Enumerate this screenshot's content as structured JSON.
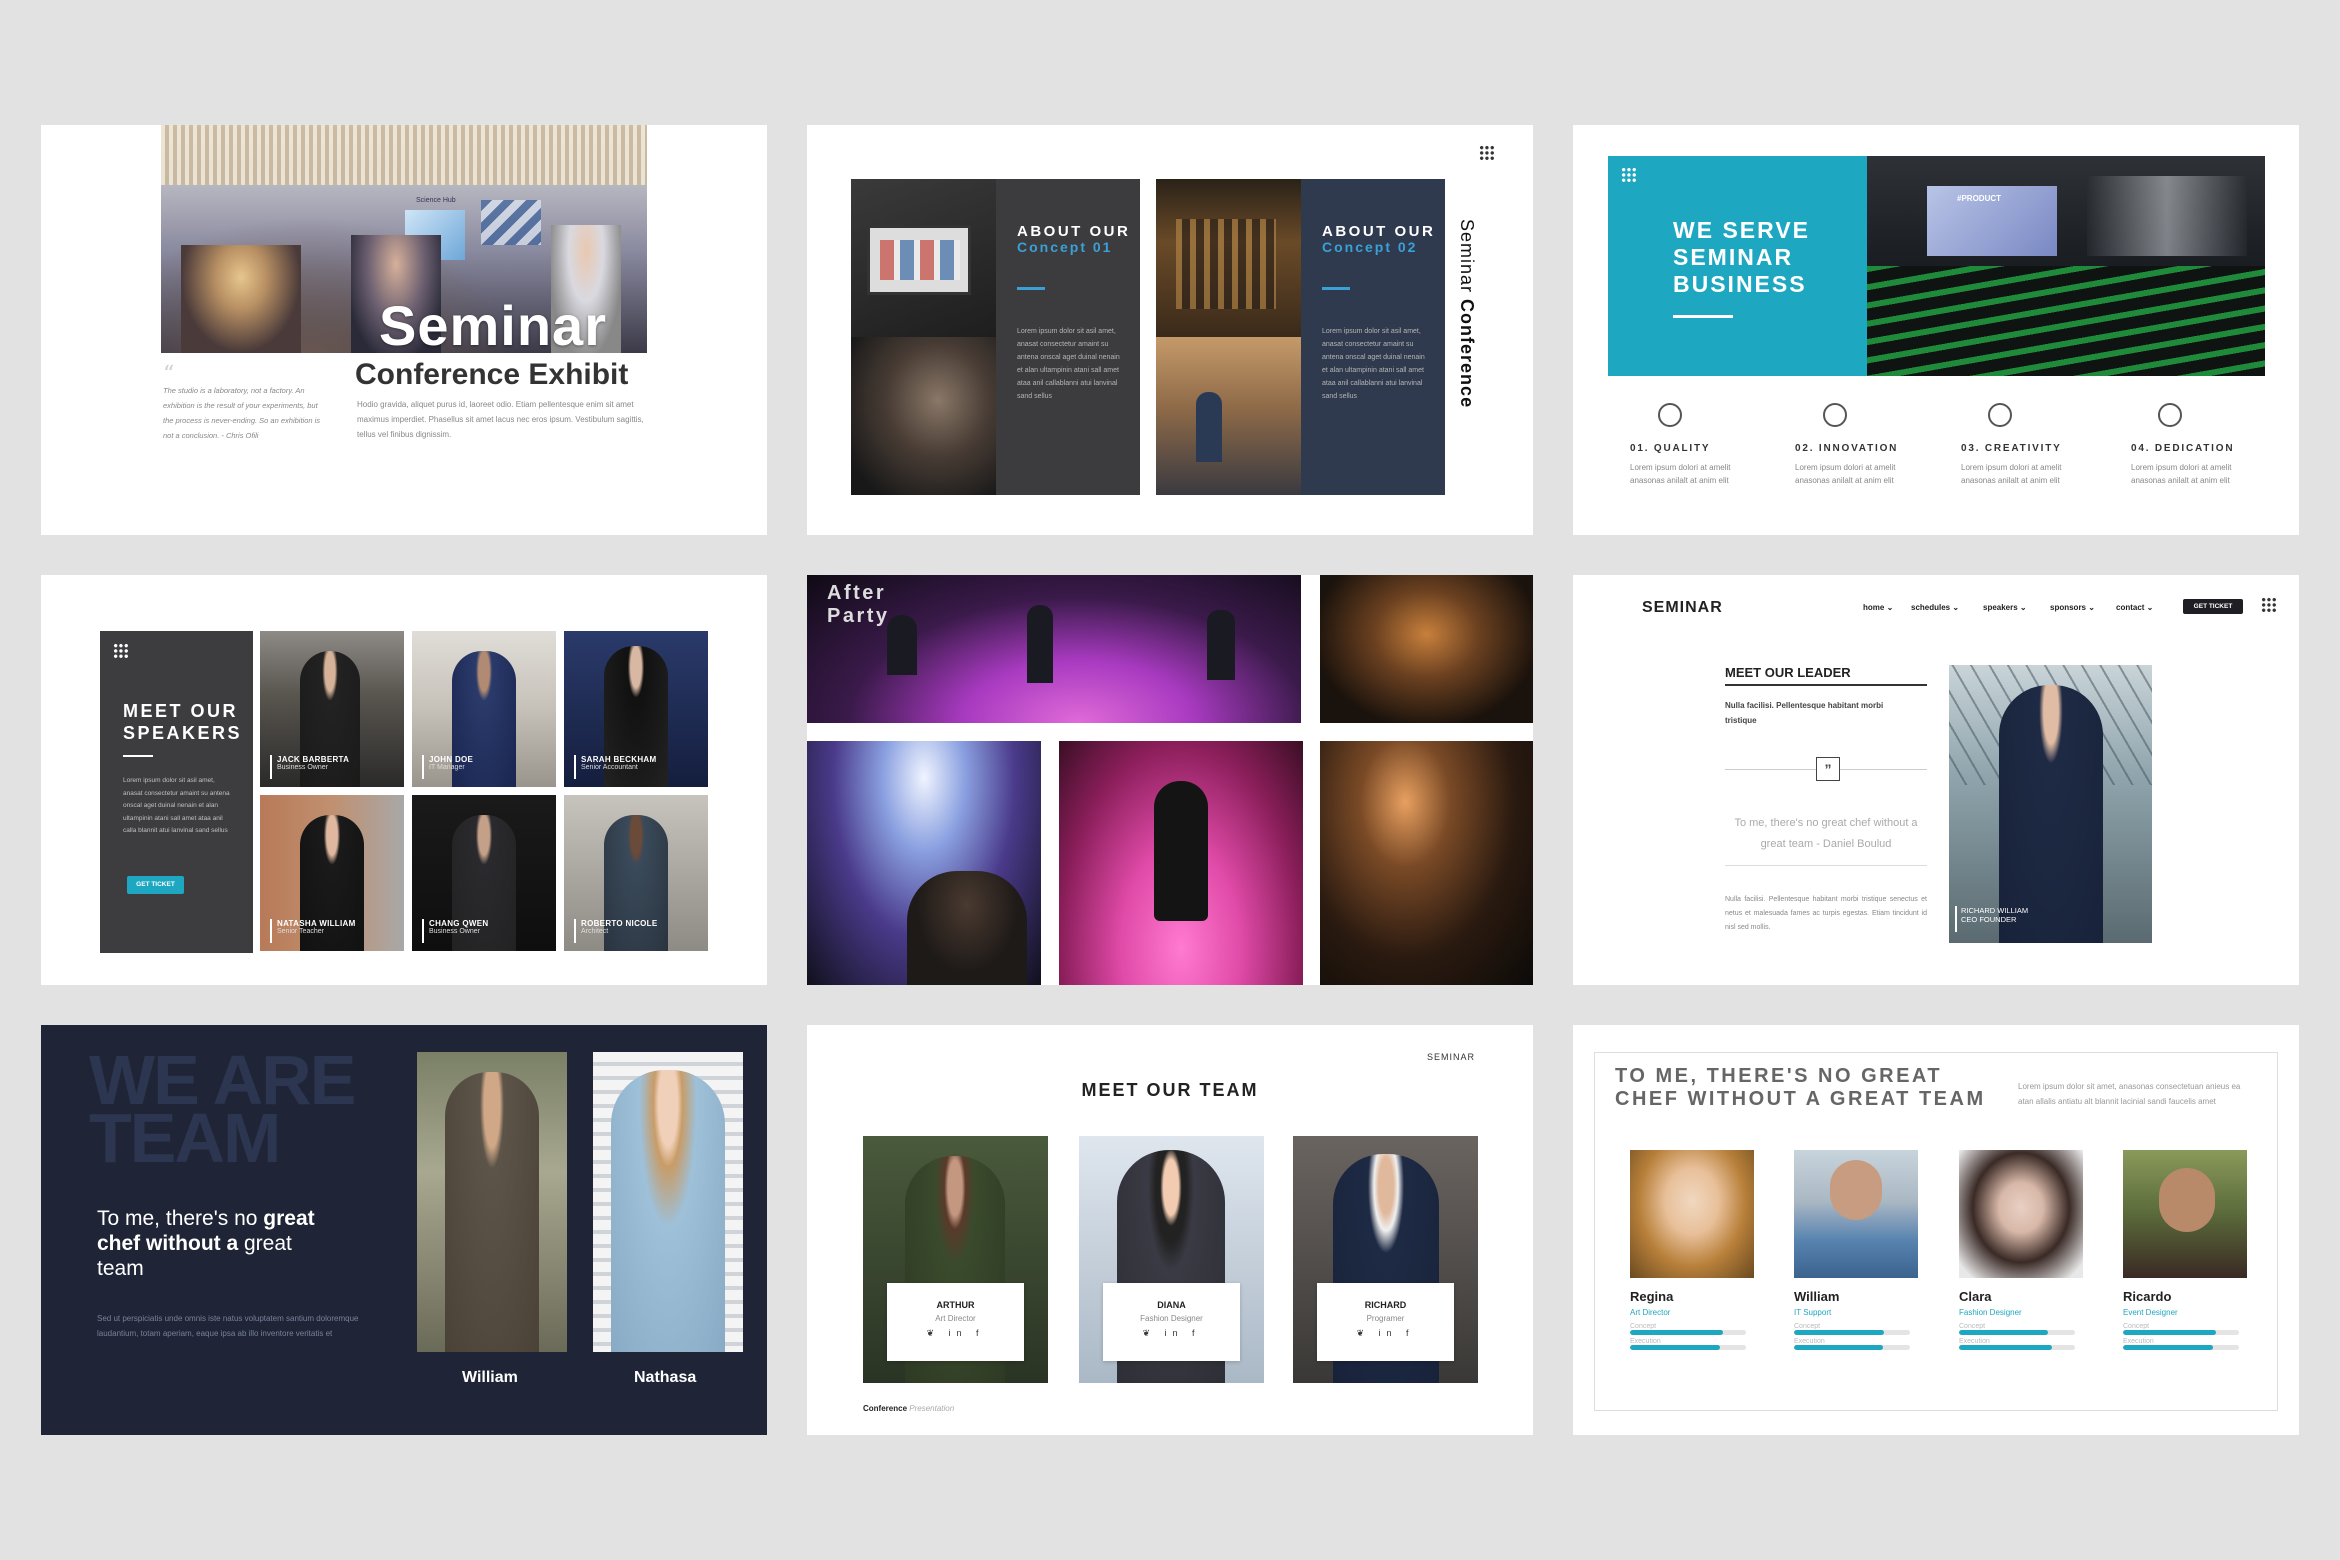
{
  "slide1": {
    "title": "Seminar",
    "subtitle": "Conference Exhibit",
    "photo_sign": "Science Hub",
    "quote": "The studio is a laboratory, not a factory. An exhibition is the result of your experiments, but the process is never-ending. So an exhibition is not a conclusion. - Chris Ofili",
    "body": "Hodio gravida, aliquet purus id, laoreet odio. Etiam pellentesque enim sit amet maximus imperdiet. Phasellus sit amet lacus nec eros ipsum. Vestibulum sagittis, tellus vel finibus dignissim."
  },
  "slide2": {
    "panels": [
      {
        "head": "ABOUT OUR",
        "sub": "Concept 01",
        "body": "Lorem ipsum dolor sit asil amet, anasat consectetur amaint su antena onscal aget duinal nenain et alan ultampinin atani sall amet ataa anil callablanni atui lanvinal sand sellus"
      },
      {
        "head": "ABOUT OUR",
        "sub": "Concept 02",
        "body": "Lorem ipsum dolor sit asil amet, anasat consectetur amaint su antena onscal aget duinal nenain et alan ultampinin atani sall amet ataa anil callablanni atui lanvinal sand sellus"
      }
    ],
    "vertical_a": "Seminar",
    "vertical_b": "Conference"
  },
  "slide3": {
    "title_lines": [
      "WE SERVE",
      "SEMINAR",
      "BUSINESS"
    ],
    "screen_text": "#PRODUCT",
    "features": [
      {
        "icon": "thumbs-up-icon",
        "label": "01. QUALITY",
        "text": "Lorem ipsum dolori at amelit anasonas anilalt at anim elit"
      },
      {
        "icon": "lightbulb-head-icon",
        "label": "02. INNOVATION",
        "text": "Lorem ipsum dolori at amelit anasonas anilalt at anim elit"
      },
      {
        "icon": "bulb-icon",
        "label": "03. CREATIVITY",
        "text": "Lorem ipsum dolori at amelit anasonas anilalt at anim elit"
      },
      {
        "icon": "gears-icon",
        "label": "04. DEDICATION",
        "text": "Lorem ipsum dolori at amelit anasonas anilalt at anim elit"
      }
    ]
  },
  "slide4": {
    "head_lines": [
      "MEET OUR",
      "SPEAKERS"
    ],
    "body": "Lorem ipsum dolor sit asil amet, anasat consectetur amaint su antena onscal aget duinal nenain et alan ultampinin atani sall amet ataa anil calla blannit atui lanvinal sand sellus",
    "button": "GET TICKET",
    "speakers": [
      {
        "name": "JACK BARBERTA",
        "role": "Business Owner"
      },
      {
        "name": "JOHN DOE",
        "role": "IT Manager"
      },
      {
        "name": "SARAH BECKHAM",
        "role": "Senior Accountant"
      },
      {
        "name": "NATASHA WILLIAM",
        "role": "Senior Teacher"
      },
      {
        "name": "CHANG QWEN",
        "role": "Business Owner"
      },
      {
        "name": "ROBERTO NICOLE",
        "role": "Architect"
      }
    ]
  },
  "slide5": {
    "title_lines": [
      "After",
      "Party"
    ]
  },
  "slide6": {
    "logo": "SEMINAR",
    "nav": [
      "home",
      "schedules",
      "speakers",
      "sponsors",
      "contact"
    ],
    "button": "GET TICKET",
    "head": "MEET OUR LEADER",
    "sub": "Nulla facilisi. Pellentesque habitant morbi tristique",
    "quote_mark": "”",
    "quote": "To me, there's no great chef without a great team - Daniel Boulud",
    "body": "Nulla facilisi. Pellentesque habitant morbi tristique senectus et netus et malesuada fames ac turpis egestas. Etiam tincidunt id nisl sed mollis.",
    "leader_name": "RICHARD WILLIAM",
    "leader_role": "CEO FOUNDER"
  },
  "slide7": {
    "big_lines": [
      "WE ARE",
      "TEAM"
    ],
    "tag_lines": [
      [
        {
          "t": "To me, there's no ",
          "b": false
        },
        {
          "t": "great",
          "b": true
        }
      ],
      [
        {
          "t": "chef without a ",
          "b": true
        },
        {
          "t": "great",
          "b": false
        }
      ],
      [
        {
          "t": "team",
          "b": false
        }
      ]
    ],
    "body": "Sed ut perspiciatis unde omnis iste natus voluptatem santium doloremque laudantium, totam aperiam, eaque ipsa ab illo inventore veritatis et",
    "people": [
      "William",
      "Nathasa"
    ]
  },
  "slide8": {
    "brand": "SEMINAR",
    "title": "MEET OUR TEAM",
    "members": [
      {
        "name": "ARTHUR",
        "role": "Art Director"
      },
      {
        "name": "DIANA",
        "role": "Fashion Designer"
      },
      {
        "name": "RICHARD",
        "role": "Programer"
      }
    ],
    "social": "❦ in f",
    "footer_a": "Conference",
    "footer_b": "Presentation"
  },
  "slide9": {
    "title_lines": [
      "TO ME, THERE'S NO GREAT",
      "CHEF WITHOUT A GREAT TEAM"
    ],
    "intro": "Lorem ipsum dolor sit amet, anasonas consectetuan anieus ea atan allalis antiatu alt blannit lacinial sandi faucelis amet",
    "k1": "Concept",
    "k2": "Execution",
    "members": [
      {
        "name": "Regina",
        "role": "Art Director",
        "concept": 0.8,
        "execution": 0.78
      },
      {
        "name": "William",
        "role": "IT Support",
        "concept": 0.78,
        "execution": 0.77
      },
      {
        "name": "Clara",
        "role": "Fashion Designer",
        "concept": 0.77,
        "execution": 0.8
      },
      {
        "name": "Ricardo",
        "role": "Event Designer",
        "concept": 0.8,
        "execution": 0.78
      }
    ]
  },
  "colors": {
    "teal": "#1ea7c0",
    "navy": "#1f2536",
    "charcoal": "#3c3c3e",
    "blue": "#3aa0d6"
  }
}
